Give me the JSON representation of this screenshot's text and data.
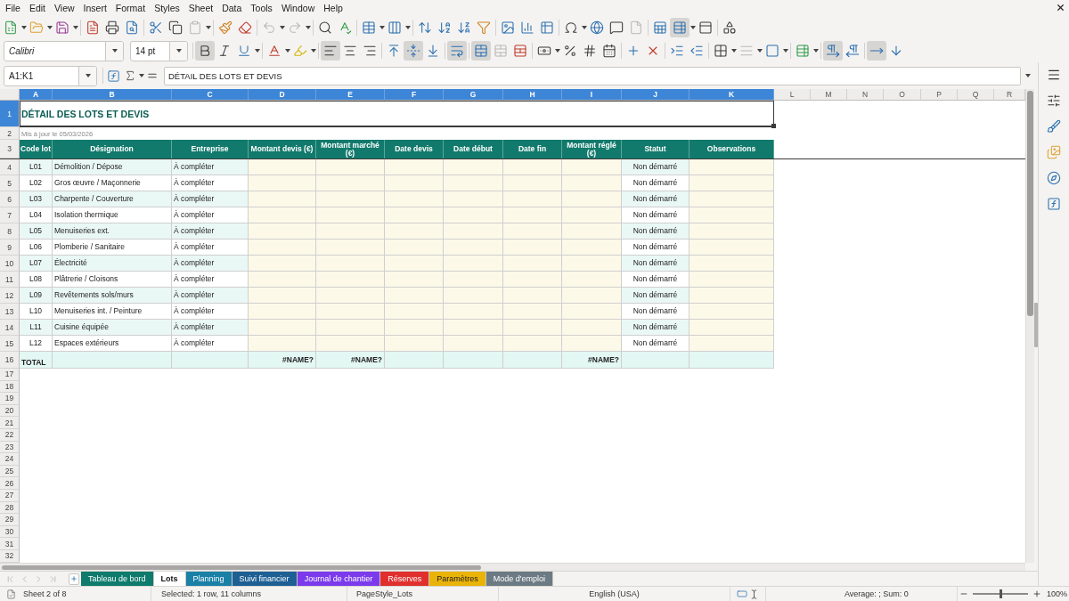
{
  "menu": [
    "File",
    "Edit",
    "View",
    "Insert",
    "Format",
    "Styles",
    "Sheet",
    "Data",
    "Tools",
    "Window",
    "Help"
  ],
  "standard_toolbar": [
    [
      {
        "kind": "new",
        "dropdown": true,
        "active": false,
        "disabled": false
      },
      {
        "kind": "open",
        "dropdown": true,
        "active": false,
        "disabled": false
      },
      {
        "kind": "save",
        "dropdown": true,
        "active": false,
        "disabled": false
      }
    ],
    [
      {
        "kind": "export_pdf",
        "dropdown": false,
        "active": false,
        "disabled": false
      },
      {
        "kind": "print",
        "dropdown": false,
        "active": false,
        "disabled": false
      },
      {
        "kind": "print_preview",
        "dropdown": false,
        "active": false,
        "disabled": false
      }
    ],
    [
      {
        "kind": "cut",
        "dropdown": false,
        "active": false,
        "disabled": false
      },
      {
        "kind": "copy",
        "dropdown": false,
        "active": false,
        "disabled": false
      },
      {
        "kind": "paste",
        "dropdown": true,
        "active": false,
        "disabled": true
      }
    ],
    [
      {
        "kind": "clone_formatting",
        "dropdown": false,
        "active": false,
        "disabled": false
      },
      {
        "kind": "clear_formatting",
        "dropdown": false,
        "active": false,
        "disabled": false
      }
    ],
    [
      {
        "kind": "undo",
        "dropdown": true,
        "active": false,
        "disabled": true
      },
      {
        "kind": "redo",
        "dropdown": true,
        "active": false,
        "disabled": true
      }
    ],
    [
      {
        "kind": "find_replace",
        "dropdown": false,
        "active": false,
        "disabled": false
      },
      {
        "kind": "spelling",
        "dropdown": false,
        "active": false,
        "disabled": false
      }
    ],
    [
      {
        "kind": "row",
        "dropdown": true,
        "active": false,
        "disabled": false
      },
      {
        "kind": "column",
        "dropdown": true,
        "active": false,
        "disabled": false
      }
    ],
    [
      {
        "kind": "sort",
        "dropdown": false,
        "active": false,
        "disabled": false
      },
      {
        "kind": "sort_ascending",
        "dropdown": false,
        "active": false,
        "disabled": false
      },
      {
        "kind": "sort_descending",
        "dropdown": false,
        "active": false,
        "disabled": false
      },
      {
        "kind": "autofilter",
        "dropdown": false,
        "active": false,
        "disabled": false
      }
    ],
    [
      {
        "kind": "image",
        "dropdown": false,
        "active": false,
        "disabled": false
      },
      {
        "kind": "chart",
        "dropdown": false,
        "active": false,
        "disabled": false
      },
      {
        "kind": "pivot_table",
        "dropdown": false,
        "active": false,
        "disabled": false
      }
    ],
    [
      {
        "kind": "special_character",
        "dropdown": true,
        "active": false,
        "disabled": false
      },
      {
        "kind": "hyperlink",
        "dropdown": false,
        "active": false,
        "disabled": false
      },
      {
        "kind": "comment",
        "dropdown": false,
        "active": false,
        "disabled": false
      },
      {
        "kind": "headers_footers",
        "dropdown": false,
        "active": false,
        "disabled": true
      }
    ],
    [
      {
        "kind": "print_area",
        "dropdown": false,
        "active": false,
        "disabled": false
      },
      {
        "kind": "freeze",
        "dropdown": true,
        "active": true,
        "disabled": false
      },
      {
        "kind": "split_window",
        "dropdown": false,
        "active": false,
        "disabled": false
      }
    ],
    [
      {
        "kind": "shapes",
        "dropdown": false,
        "active": false,
        "disabled": false
      }
    ]
  ],
  "formatting_toolbar": {
    "font_name": "Calibri",
    "font_size": "14 pt",
    "groups": [
      [
        {
          "kind": "bold",
          "dropdown": false,
          "active": true,
          "disabled": false
        },
        {
          "kind": "italic",
          "dropdown": false,
          "active": false,
          "disabled": false
        },
        {
          "kind": "underline",
          "dropdown": true,
          "active": false,
          "disabled": false
        }
      ],
      [
        {
          "kind": "font_color",
          "dropdown": true,
          "active": false,
          "disabled": false
        },
        {
          "kind": "highlight",
          "dropdown": true,
          "active": false,
          "disabled": false
        }
      ],
      [
        {
          "kind": "align_left",
          "dropdown": false,
          "active": true,
          "disabled": false
        },
        {
          "kind": "align_center",
          "dropdown": false,
          "active": false,
          "disabled": false
        },
        {
          "kind": "align_right",
          "dropdown": false,
          "active": false,
          "disabled": false
        }
      ],
      [
        {
          "kind": "align_top",
          "dropdown": false,
          "active": false,
          "disabled": false
        },
        {
          "kind": "align_middle",
          "dropdown": false,
          "active": true,
          "disabled": false
        },
        {
          "kind": "align_bottom",
          "dropdown": false,
          "active": false,
          "disabled": false
        }
      ],
      [
        {
          "kind": "wrap_text",
          "dropdown": false,
          "active": true,
          "disabled": false
        }
      ],
      [
        {
          "kind": "merge_center",
          "dropdown": false,
          "active": true,
          "disabled": false
        },
        {
          "kind": "merge_cells",
          "dropdown": false,
          "active": false,
          "disabled": true
        },
        {
          "kind": "unmerge_cells",
          "dropdown": false,
          "active": false,
          "disabled": false
        }
      ],
      [
        {
          "kind": "currency",
          "dropdown": true,
          "active": false,
          "disabled": false
        },
        {
          "kind": "percent",
          "dropdown": false,
          "active": false,
          "disabled": false
        },
        {
          "kind": "number",
          "dropdown": false,
          "active": false,
          "disabled": false
        },
        {
          "kind": "date",
          "dropdown": false,
          "active": false,
          "disabled": false
        }
      ],
      [
        {
          "kind": "add_decimal",
          "dropdown": false,
          "active": false,
          "disabled": false
        },
        {
          "kind": "delete_decimal",
          "dropdown": false,
          "active": false,
          "disabled": false
        }
      ],
      [
        {
          "kind": "indent_increase",
          "dropdown": false,
          "active": false,
          "disabled": false
        },
        {
          "kind": "indent_decrease",
          "dropdown": false,
          "active": false,
          "disabled": false
        }
      ],
      [
        {
          "kind": "borders",
          "dropdown": true,
          "active": false,
          "disabled": false
        },
        {
          "kind": "border_style",
          "dropdown": true,
          "active": false,
          "disabled": true
        },
        {
          "kind": "border_color",
          "dropdown": true,
          "active": false,
          "disabled": false
        }
      ],
      [
        {
          "kind": "conditional",
          "dropdown": true,
          "active": false,
          "disabled": false
        }
      ],
      [
        {
          "kind": "ltr",
          "dropdown": false,
          "active": true,
          "disabled": false
        },
        {
          "kind": "rtl",
          "dropdown": false,
          "active": false,
          "disabled": false
        }
      ],
      [
        {
          "kind": "text_horizontal",
          "dropdown": false,
          "active": true,
          "disabled": false
        },
        {
          "kind": "text_vertical",
          "dropdown": false,
          "active": false,
          "disabled": false
        }
      ]
    ]
  },
  "formula_bar": {
    "name_box": "A1:K1",
    "content": "DÉTAIL DES LOTS ET DEVIS"
  },
  "sheet": {
    "columns": [
      {
        "label": "A",
        "selected": true
      },
      {
        "label": "B",
        "selected": true
      },
      {
        "label": "C",
        "selected": true
      },
      {
        "label": "D",
        "selected": true
      },
      {
        "label": "E",
        "selected": true
      },
      {
        "label": "F",
        "selected": true
      },
      {
        "label": "G",
        "selected": true
      },
      {
        "label": "H",
        "selected": true
      },
      {
        "label": "I",
        "selected": true
      },
      {
        "label": "J",
        "selected": true
      },
      {
        "label": "K",
        "selected": true
      },
      {
        "label": "L",
        "selected": false
      },
      {
        "label": "M",
        "selected": false
      },
      {
        "label": "N",
        "selected": false
      },
      {
        "label": "O",
        "selected": false
      },
      {
        "label": "P",
        "selected": false
      },
      {
        "label": "Q",
        "selected": false
      },
      {
        "label": "R",
        "selected": false
      }
    ],
    "row_headers": [
      {
        "label": "1",
        "selected": true
      },
      {
        "label": "2",
        "selected": false
      },
      {
        "label": "3",
        "selected": false
      },
      {
        "label": "4",
        "selected": false
      },
      {
        "label": "5",
        "selected": false
      },
      {
        "label": "6",
        "selected": false
      },
      {
        "label": "7",
        "selected": false
      },
      {
        "label": "8",
        "selected": false
      },
      {
        "label": "9",
        "selected": false
      },
      {
        "label": "10",
        "selected": false
      },
      {
        "label": "11",
        "selected": false
      },
      {
        "label": "12",
        "selected": false
      },
      {
        "label": "13",
        "selected": false
      },
      {
        "label": "14",
        "selected": false
      },
      {
        "label": "15",
        "selected": false
      },
      {
        "label": "16",
        "selected": false
      },
      {
        "label": "17",
        "selected": false
      },
      {
        "label": "18",
        "selected": false
      },
      {
        "label": "19",
        "selected": false
      },
      {
        "label": "20",
        "selected": false
      },
      {
        "label": "21",
        "selected": false
      },
      {
        "label": "22",
        "selected": false
      },
      {
        "label": "23",
        "selected": false
      },
      {
        "label": "24",
        "selected": false
      },
      {
        "label": "25",
        "selected": false
      },
      {
        "label": "26",
        "selected": false
      },
      {
        "label": "27",
        "selected": false
      },
      {
        "label": "28",
        "selected": false
      },
      {
        "label": "29",
        "selected": false
      },
      {
        "label": "30",
        "selected": false
      },
      {
        "label": "31",
        "selected": false
      },
      {
        "label": "32",
        "selected": false
      }
    ],
    "title": {
      "text": "DÉTAIL DES LOTS ET DEVIS",
      "selected": true
    },
    "updated": "Mis à jour le 05/03/2026",
    "headers": [
      "Code lot",
      "Désignation",
      "Entreprise",
      "Montant devis (€)",
      "Montant marché (€)",
      "Date devis",
      "Date début",
      "Date fin",
      "Montant réglé (€)",
      "Statut",
      "Observations"
    ],
    "rows": [
      {
        "code": "L01",
        "designation": "Démolition / Dépose",
        "company": "À compléter",
        "status": "Non démarré"
      },
      {
        "code": "L02",
        "designation": "Gros œuvre / Maçonnerie",
        "company": "À compléter",
        "status": "Non démarré"
      },
      {
        "code": "L03",
        "designation": "Charpente / Couverture",
        "company": "À compléter",
        "status": "Non démarré"
      },
      {
        "code": "L04",
        "designation": "Isolation thermique",
        "company": "À compléter",
        "status": "Non démarré"
      },
      {
        "code": "L05",
        "designation": "Menuiseries ext.",
        "company": "À compléter",
        "status": "Non démarré"
      },
      {
        "code": "L06",
        "designation": "Plomberie / Sanitaire",
        "company": "À compléter",
        "status": "Non démarré"
      },
      {
        "code": "L07",
        "designation": "Électricité",
        "company": "À compléter",
        "status": "Non démarré"
      },
      {
        "code": "L08",
        "designation": "Plâtrerie / Cloisons",
        "company": "À compléter",
        "status": "Non démarré"
      },
      {
        "code": "L09",
        "designation": "Revêtements sols/murs",
        "company": "À compléter",
        "status": "Non démarré"
      },
      {
        "code": "L10",
        "designation": "Menuiseries int. / Peinture",
        "company": "À compléter",
        "status": "Non démarré"
      },
      {
        "code": "L11",
        "designation": "Cuisine équipée",
        "company": "À compléter",
        "status": "Non démarré"
      },
      {
        "code": "L12",
        "designation": "Espaces extérieurs",
        "company": "À compléter",
        "status": "Non démarré"
      }
    ],
    "total": {
      "label": "TOTAL",
      "montant_devis": "#NAME?",
      "montant_marche": "#NAME?",
      "montant_regle": "#NAME?"
    }
  },
  "sheet_navigation": [
    {
      "disabled": true
    },
    {
      "disabled": true
    },
    {
      "disabled": true
    },
    {
      "disabled": true
    }
  ],
  "sheet_tabs": [
    {
      "label": "Tableau de bord",
      "selected": false,
      "color": "#0f7b6c"
    },
    {
      "label": "Lots",
      "selected": true
    },
    {
      "label": "Planning",
      "selected": false,
      "color": "#1a80a6"
    },
    {
      "label": "Suivi financier",
      "selected": false,
      "color": "#1e5f94"
    },
    {
      "label": "Journal de chantier",
      "selected": false,
      "color": "#7c3aed"
    },
    {
      "label": "Réserves",
      "selected": false,
      "color": "#e0302e"
    },
    {
      "label": "Paramètres",
      "selected": false,
      "color": "#eab308"
    },
    {
      "label": "Mode d'emploi",
      "selected": false,
      "color": "#6b7a83"
    }
  ],
  "status_bar": {
    "sheet": "Sheet 2 of 8",
    "selection": "Selected: 1 row, 11 columns",
    "page_style": "PageStyle_Lots",
    "language": "English (USA)",
    "summary": "Average: ; Sum: 0",
    "zoom": {
      "level": 0.5,
      "reading": "100%"
    }
  }
}
